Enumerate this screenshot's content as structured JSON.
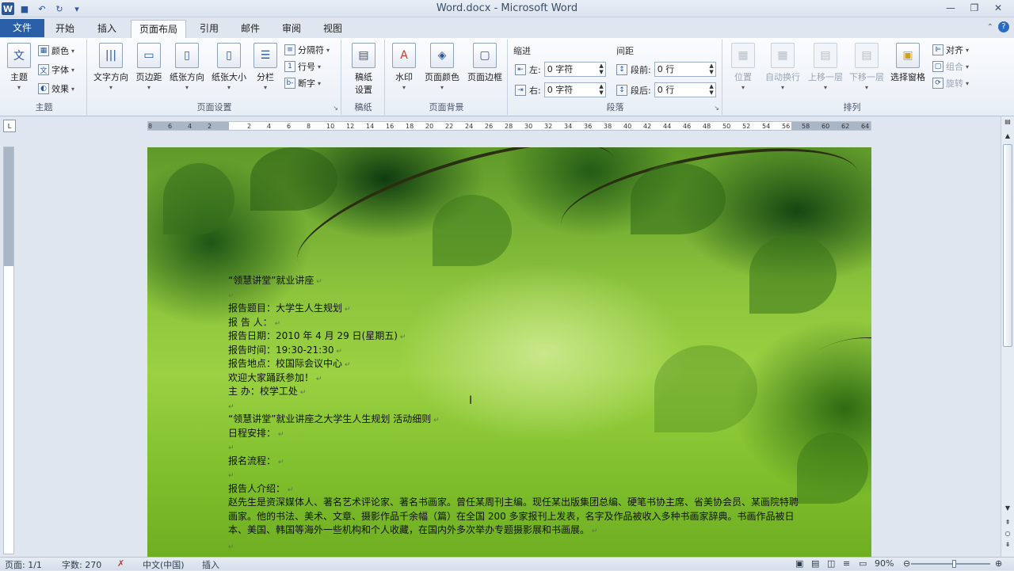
{
  "titlebar": {
    "title": "Word.docx - Microsoft Word"
  },
  "tabs": [
    {
      "label": "文件"
    },
    {
      "label": "开始"
    },
    {
      "label": "插入"
    },
    {
      "label": "页面布局"
    },
    {
      "label": "引用"
    },
    {
      "label": "邮件"
    },
    {
      "label": "审阅"
    },
    {
      "label": "视图"
    }
  ],
  "ribbon": {
    "theme": {
      "main": "主题",
      "colors": "颜色",
      "fonts": "字体",
      "effects": "效果",
      "group": "主题"
    },
    "page_setup": {
      "text_direction": "文字方向",
      "margins": "页边距",
      "orientation": "纸张方向",
      "size": "纸张大小",
      "columns": "分栏",
      "breaks": "分隔符",
      "line_numbers": "行号",
      "hyphenation": "断字",
      "group": "页面设置"
    },
    "draft": {
      "btn_line1": "稿纸",
      "btn_line2": "设置",
      "group": "稿纸"
    },
    "background": {
      "watermark": "水印",
      "page_color": "页面颜色",
      "page_borders": "页面边框",
      "group": "页面背景"
    },
    "paragraph": {
      "indent": "缩进",
      "spacing": "间距",
      "left": "左:",
      "right": "右:",
      "before": "段前:",
      "after": "段后:",
      "left_val": "0 字符",
      "right_val": "0 字符",
      "before_val": "0 行",
      "after_val": "0 行",
      "group": "段落"
    },
    "arrange": {
      "position": "位置",
      "wrap": "自动换行",
      "forward": "上移一层",
      "backward": "下移一层",
      "selection_pane": "选择窗格",
      "align": "对齐",
      "group_btn": "组合",
      "rotate": "旋转",
      "group": "排列"
    }
  },
  "ruler": {
    "ticks": [
      "8",
      "6",
      "4",
      "2",
      "",
      "2",
      "4",
      "6",
      "8",
      "10",
      "12",
      "14",
      "16",
      "18",
      "20",
      "22",
      "24",
      "26",
      "28",
      "30",
      "32",
      "34",
      "36",
      "38",
      "40",
      "42",
      "44",
      "46",
      "48",
      "50",
      "52",
      "54",
      "56",
      "58",
      "60",
      "62",
      "64"
    ]
  },
  "document": {
    "lines": [
      "“领慧讲堂”就业讲座",
      "",
      "报告题目：大学生人生规划",
      "报 告 人：",
      "报告日期：2010 年 4 月 29 日(星期五)",
      "报告时间：19:30-21:30",
      "报告地点：校国际会议中心",
      "欢迎大家踊跃参加！",
      "主 办：校学工处",
      "",
      "“领慧讲堂”就业讲座之大学生人生规划 活动细则",
      "日程安排：",
      "",
      "报名流程：",
      "",
      "报告人介绍：",
      "赵先生是资深媒体人、著名艺术评论家、著名书画家。曾任某周刊主编。现任某出版集团总编、硬笔书协主席、省美协会员、某画院特聘画家。他的书法、美术、文章、摄影作品千余幅（篇）在全国 200 多家报刊上发表，名字及作品被收入多种书画家辞典。书画作品被日本、美国、韩国等海外一些机构和个人收藏，在国内外多次举办专题摄影展和书画展。",
      ""
    ]
  },
  "status": {
    "page": "页面: 1/1",
    "words": "字数: 270",
    "lang": "中文(中国)",
    "mode": "插入",
    "zoom": "90%"
  }
}
